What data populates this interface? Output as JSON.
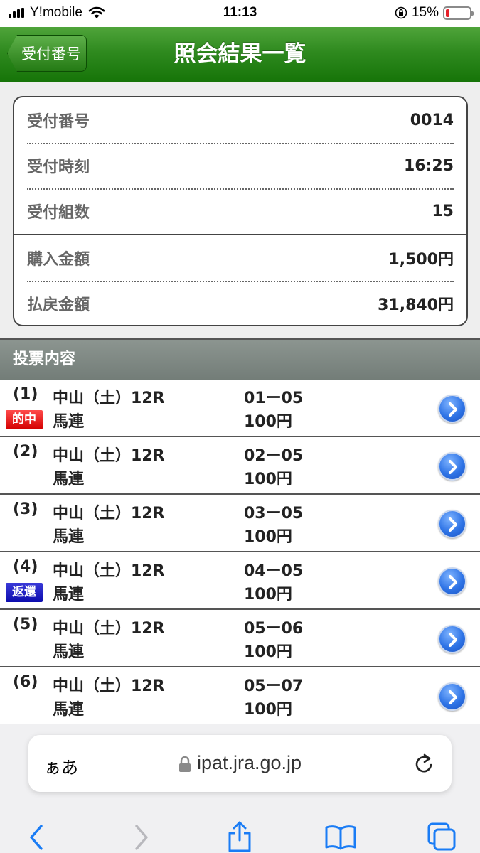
{
  "status": {
    "carrier": "Y!mobile",
    "time": "11:13",
    "battery": "15%",
    "battery_level": 0.15
  },
  "header": {
    "back_label": "受付番号",
    "title": "照会結果一覧"
  },
  "summary": {
    "rows": [
      {
        "label": "受付番号",
        "value": "0014"
      },
      {
        "label": "受付時刻",
        "value": "16:25"
      },
      {
        "label": "受付組数",
        "value": "15"
      },
      {
        "label": "購入金額",
        "value": "1,500円"
      },
      {
        "label": "払戻金額",
        "value": "31,840円"
      }
    ]
  },
  "section": {
    "title": "投票内容"
  },
  "bets": [
    {
      "num": "(1)",
      "race": "中山（土）12R",
      "type": "馬連",
      "combo": "01ー05",
      "amount": "100円",
      "badge": "的中"
    },
    {
      "num": "(2)",
      "race": "中山（土）12R",
      "type": "馬連",
      "combo": "02ー05",
      "amount": "100円",
      "badge": ""
    },
    {
      "num": "(3)",
      "race": "中山（土）12R",
      "type": "馬連",
      "combo": "03ー05",
      "amount": "100円",
      "badge": ""
    },
    {
      "num": "(4)",
      "race": "中山（土）12R",
      "type": "馬連",
      "combo": "04ー05",
      "amount": "100円",
      "badge": "返還"
    },
    {
      "num": "(5)",
      "race": "中山（土）12R",
      "type": "馬連",
      "combo": "05ー06",
      "amount": "100円",
      "badge": ""
    },
    {
      "num": "(6)",
      "race": "中山（土）12R",
      "type": "馬連",
      "combo": "05ー07",
      "amount": "100円",
      "badge": ""
    }
  ],
  "browser": {
    "aa_label": "ぁあ",
    "url": "ipat.jra.go.jp"
  },
  "colors": {
    "header_green": "#2f8a1f",
    "hit_badge": "#e00000",
    "refund_badge": "#1a1ac0",
    "chevron_blue": "#2f74e6",
    "ios_blue": "#1a7cf5"
  }
}
